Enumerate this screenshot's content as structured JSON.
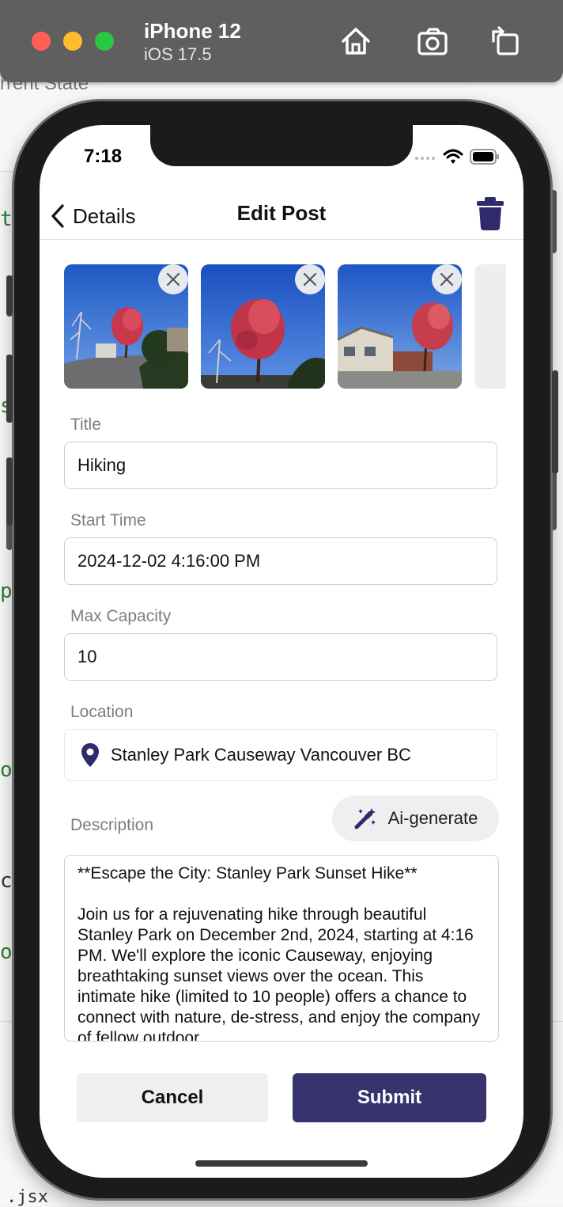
{
  "simulator": {
    "device_name": "iPhone 12",
    "os_version": "iOS 17.5",
    "icons": [
      "home-icon",
      "screenshot-icon",
      "rotate-icon"
    ]
  },
  "background": {
    "lines": [
      "rrent State",
      "ti",
      "st",
      "p",
      "on",
      "cr",
      "of",
      ".jsx"
    ]
  },
  "status_bar": {
    "time": "7:18"
  },
  "nav": {
    "back_label": "Details",
    "title": "Edit Post",
    "trash_icon": "trash-icon"
  },
  "photos": {
    "count": 3,
    "remove_icon": "close-icon"
  },
  "form": {
    "title_label": "Title",
    "title_value": "Hiking",
    "start_time_label": "Start Time",
    "start_time_value": "2024-12-02  4:16:00 PM",
    "capacity_label": "Max Capacity",
    "capacity_value": "10",
    "location_label": "Location",
    "location_value": "Stanley Park Causeway Vancouver BC",
    "description_label": "Description",
    "ai_button_label": "Ai-generate",
    "description_heading": "**Escape the City: Stanley Park Sunset Hike**",
    "description_body": "Join us for a rejuvenating hike through beautiful Stanley Park on December 2nd, 2024, starting at 4:16 PM.  We'll explore the iconic Causeway, enjoying breathtaking sunset views over the ocean.  This intimate hike (limited to 10 people) offers a chance to connect with nature, de-stress, and enjoy the company of fellow outdoor"
  },
  "actions": {
    "cancel_label": "Cancel",
    "submit_label": "Submit"
  },
  "colors": {
    "accent": "#36336f",
    "pin": "#2f2a6b"
  }
}
